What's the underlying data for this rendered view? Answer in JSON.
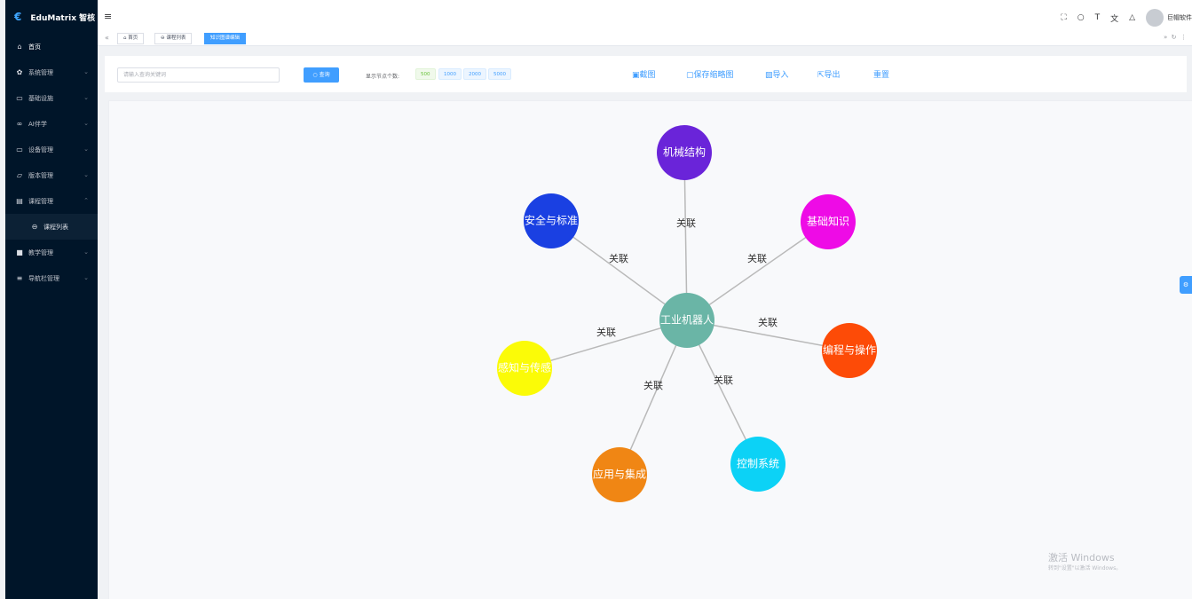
{
  "app": {
    "title": "EduMatrix 智核",
    "user_name": "巨帽软件"
  },
  "sidebar": {
    "items": [
      {
        "label": "首页",
        "icon": "home-icon"
      },
      {
        "label": "系统管理",
        "icon": "gear-icon"
      },
      {
        "label": "基础设施",
        "icon": "monitor-icon"
      },
      {
        "label": "AI伴学",
        "icon": "ai-icon"
      },
      {
        "label": "设备管理",
        "icon": "monitor-icon"
      },
      {
        "label": "版本管理",
        "icon": "folder-icon"
      },
      {
        "label": "课程管理",
        "icon": "calendar-icon"
      },
      {
        "label": "课程列表",
        "icon": "circle-icon"
      },
      {
        "label": "教学管理",
        "icon": "book-icon"
      },
      {
        "label": "导航栏管理",
        "icon": "list-icon"
      }
    ]
  },
  "tags": {
    "items": [
      "首页",
      "课程列表",
      "知识图谱编辑"
    ]
  },
  "toolbar": {
    "search_placeholder": "请输入查询关键词",
    "search_button": "查询",
    "node_count_label": "显示节点个数:",
    "node_options": [
      "500",
      "1000",
      "2000",
      "5000"
    ],
    "screenshot": "截图",
    "save_thumbnail": "保存缩略图",
    "import": "导入",
    "export": "导出",
    "reset": "重置"
  },
  "graph": {
    "center": {
      "label": "工业机器人",
      "color": "#6ab5a6"
    },
    "nodes": [
      {
        "label": "机械结构",
        "color": "#6a24d9"
      },
      {
        "label": "基础知识",
        "color": "#ee0be6"
      },
      {
        "label": "编程与操作",
        "color": "#fd4b07"
      },
      {
        "label": "控制系统",
        "color": "#0cd2f6"
      },
      {
        "label": "应用与集成",
        "color": "#f08614"
      },
      {
        "label": "感知与传感",
        "color": "#fbfb07"
      },
      {
        "label": "安全与标准",
        "color": "#1a40e2"
      }
    ],
    "edge_label": "关联"
  },
  "watermark": {
    "line1": "激活 Windows",
    "line2": "转到\"设置\"以激活 Windows。"
  }
}
